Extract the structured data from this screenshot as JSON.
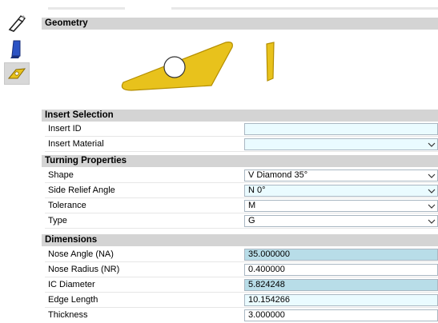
{
  "sections": {
    "geometry": "Geometry",
    "insert_selection": "Insert Selection",
    "turning_properties": "Turning Properties",
    "dimensions": "Dimensions"
  },
  "insert_selection": {
    "insert_id": {
      "label": "Insert ID",
      "value": ""
    },
    "insert_material": {
      "label": "Insert Material",
      "value": ""
    }
  },
  "turning_properties": {
    "shape": {
      "label": "Shape",
      "value": "V Diamond 35°"
    },
    "side_relief_angle": {
      "label": "Side Relief Angle",
      "value": "N  0°"
    },
    "tolerance": {
      "label": "Tolerance",
      "value": "M"
    },
    "type": {
      "label": "Type",
      "value": "G"
    }
  },
  "dimensions": {
    "nose_angle": {
      "label": "Nose Angle (NA)",
      "value": "35.000000"
    },
    "nose_radius": {
      "label": "Nose Radius (NR)",
      "value": "0.400000"
    },
    "ic_diameter": {
      "label": "IC Diameter",
      "value": "5.824248"
    },
    "edge_length": {
      "label": "Edge Length",
      "value": "10.154266"
    },
    "thickness": {
      "label": "Thickness",
      "value": "3.000000"
    }
  },
  "icons": {
    "side_tool_1": "tool-holder-icon",
    "side_tool_2": "blade-icon",
    "side_tool_3": "insert-icon",
    "dropdown": "chevron-down-icon"
  },
  "colors": {
    "insert_fill": "#e8c21c",
    "insert_stroke": "#b48e00",
    "section_header": "#d4d4d4",
    "empty_field": "#eafbff",
    "computed_field": "#b8dde8"
  }
}
